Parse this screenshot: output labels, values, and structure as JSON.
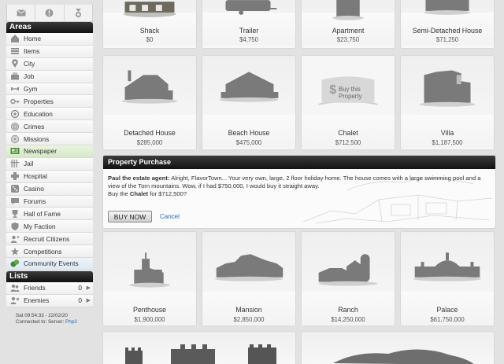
{
  "sidebar": {
    "areas_title": "Areas",
    "areas": [
      {
        "label": "Home",
        "icon": "home-icon"
      },
      {
        "label": "Items",
        "icon": "items-icon"
      },
      {
        "label": "City",
        "icon": "city-pin-icon"
      },
      {
        "label": "Job",
        "icon": "briefcase-icon"
      },
      {
        "label": "Gym",
        "icon": "dumbbell-icon"
      },
      {
        "label": "Properties",
        "icon": "key-icon"
      },
      {
        "label": "Education",
        "icon": "education-icon"
      },
      {
        "label": "Crimes",
        "icon": "fingerprint-icon"
      },
      {
        "label": "Missions",
        "icon": "missions-icon"
      },
      {
        "label": "Newspaper",
        "icon": "newspaper-icon"
      },
      {
        "label": "Jail",
        "icon": "jail-icon"
      },
      {
        "label": "Hospital",
        "icon": "hospital-cross-icon"
      },
      {
        "label": "Casino",
        "icon": "dice-icon"
      },
      {
        "label": "Forums",
        "icon": "forums-icon"
      },
      {
        "label": "Hall of Fame",
        "icon": "trophy-icon"
      },
      {
        "label": "My Faction",
        "icon": "faction-icon"
      },
      {
        "label": "Recruit Citizens",
        "icon": "recruit-icon"
      },
      {
        "label": "Competitions",
        "icon": "competitions-icon"
      },
      {
        "label": "Community Events",
        "icon": "community-events-icon"
      }
    ],
    "lists_title": "Lists",
    "lists": [
      {
        "label": "Friends",
        "count": "0",
        "icon": "friends-icon"
      },
      {
        "label": "Enemies",
        "count": "0",
        "icon": "enemies-icon"
      }
    ],
    "status_time": "Sat 09:54:33 - 22/02/20",
    "status_server_prefix": "Connected to: Server:",
    "status_server_name": "Php3"
  },
  "properties": [
    {
      "name": "Shack",
      "price": "$0"
    },
    {
      "name": "Trailer",
      "price": "$4,750"
    },
    {
      "name": "Apartment",
      "price": "$23,750"
    },
    {
      "name": "Semi-Detached House",
      "price": "$71,250"
    },
    {
      "name": "Detached House",
      "price": "$285,000"
    },
    {
      "name": "Beach House",
      "price": "$475,000"
    },
    {
      "name": "Chalet",
      "price": "$712,500"
    },
    {
      "name": "Villa",
      "price": "$1,187,500"
    },
    {
      "name": "Penthouse",
      "price": "$1,900,000"
    },
    {
      "name": "Mansion",
      "price": "$2,850,000"
    },
    {
      "name": "Ranch",
      "price": "$14,250,000"
    },
    {
      "name": "Palace",
      "price": "$61,750,000"
    }
  ],
  "chalet_overlay": {
    "line1": "Buy this",
    "line2": "Property"
  },
  "purchase": {
    "title": "Property Purchase",
    "agent_label": "Paul the estate agent:",
    "agent_text": " Alright, FlavorTown... Your very own, large, 2 floor holiday home. The house comes with a large swimming pool and a view of the Torn mountains. Wow, if I had $750,000, I would buy it straight away.",
    "question_prefix": "Buy the ",
    "question_item": "Chalet",
    "question_suffix": " for $712,500?",
    "buy_label": "BUY NOW",
    "cancel_label": "Cancel"
  }
}
